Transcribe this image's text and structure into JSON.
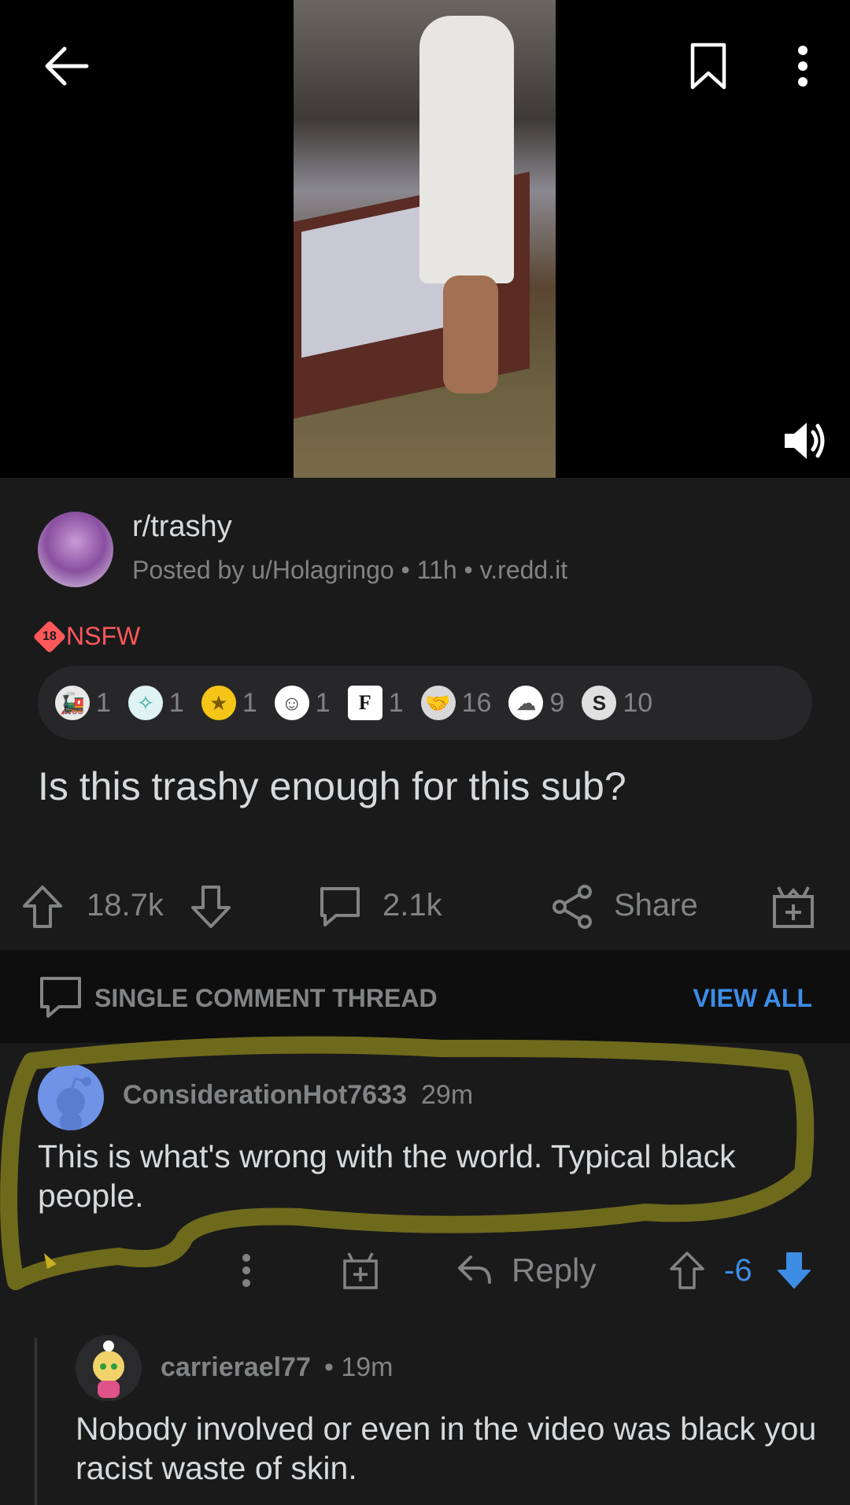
{
  "post": {
    "subreddit": "r/trashy",
    "posted_by": "Posted by u/Holagringo",
    "age": "11h",
    "domain": "v.redd.it",
    "nsfw_badge": "18",
    "nsfw_label": "NSFW",
    "title": "Is this trashy enough for this sub?",
    "upvotes": "18.7k",
    "comments": "2.1k",
    "share_label": "Share"
  },
  "awards": [
    {
      "icon": "train-award",
      "count": "1",
      "color": "#e8e8e8"
    },
    {
      "icon": "compass-award",
      "count": "1",
      "color": "#57c8c1"
    },
    {
      "icon": "star-award",
      "count": "1",
      "color": "#f5c518"
    },
    {
      "icon": "face-award",
      "count": "1",
      "color": "#ffffff"
    },
    {
      "icon": "f-award",
      "count": "1",
      "color": "#ffffff"
    },
    {
      "icon": "handshake-award",
      "count": "16",
      "color": "#d8d8d8"
    },
    {
      "icon": "bubble-award",
      "count": "9",
      "color": "#ffffff"
    },
    {
      "icon": "s-award",
      "count": "10",
      "color": "#e0e0e0"
    }
  ],
  "thread": {
    "label": "SINGLE COMMENT THREAD",
    "view_all": "VIEW ALL"
  },
  "comment": {
    "user": "ConsiderationHot7633",
    "time": "29m",
    "body": "This is what's wrong with the world. Typical black people.",
    "reply_label": "Reply",
    "score": "-6"
  },
  "reply": {
    "user": "carrierael77",
    "time": "• 19m",
    "body": "Nobody involved or even in the video was black you racist waste of skin."
  },
  "colors": {
    "background": "#1a1a1b",
    "nsfw": "#ff585b",
    "link_blue": "#3d8de5",
    "downvote_active": "#3d8de5",
    "highlight": "#7a7420"
  }
}
